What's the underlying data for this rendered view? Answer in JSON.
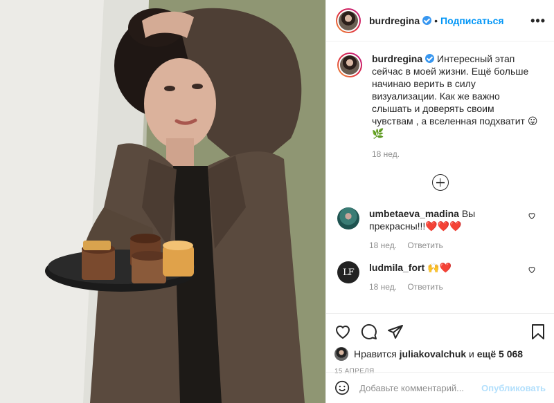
{
  "header": {
    "username": "burdregina",
    "dot": "•",
    "follow_label": "Подписаться",
    "more_label": "•••"
  },
  "caption": {
    "username": "burdregina",
    "text": "Интересный этап сейчас в моей жизни. Ещё больше начинаю верить в силу визуализации. Как же важно слышать и доверять своим чувствам , а вселенная подхватит 😛🌿",
    "time": "18 нед."
  },
  "comments": [
    {
      "username": "umbetaeva_madina",
      "text": "Вы прекрасны!!!❤️❤️❤️",
      "time": "18 нед.",
      "reply": "Ответить"
    },
    {
      "username": "ludmila_fort",
      "avatar_text": "LF",
      "text": "🙌❤️",
      "time": "18 нед.",
      "reply": "Ответить"
    }
  ],
  "likes": {
    "prefix": "Нравится",
    "user": "juliakovalchuk",
    "middle": "и",
    "rest": "ещё 5 068"
  },
  "date": "15 апреля",
  "add_comment": {
    "placeholder": "Добавьте комментарий...",
    "publish_label": "Опубликовать"
  },
  "icons": {
    "like": "heart-icon",
    "comment": "comment-icon",
    "share": "paper-plane-icon",
    "save": "bookmark-icon",
    "emoji": "smiley-icon",
    "load_more": "plus-circle-icon"
  },
  "colors": {
    "accent": "#0095f6",
    "verified": "#3897f0",
    "muted": "#8e8e8e",
    "publish_disabled": "#b2dffc"
  }
}
